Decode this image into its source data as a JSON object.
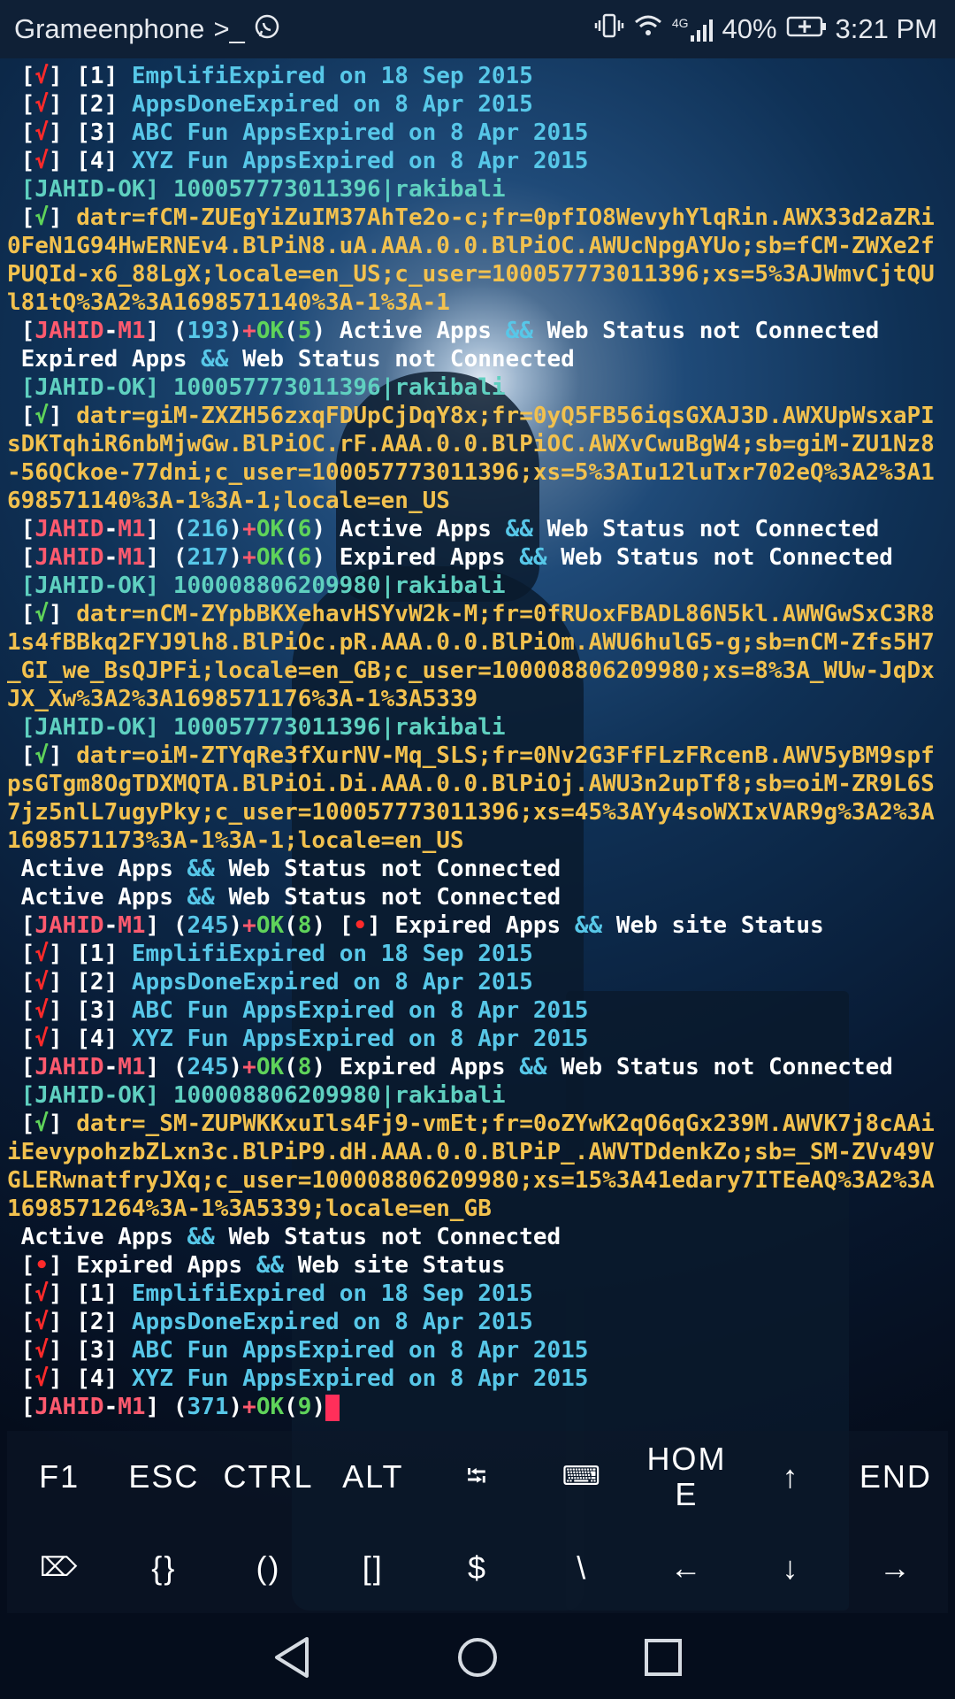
{
  "status_bar": {
    "carrier": "Grameenphone",
    "terminal_glyph": ">_",
    "network_label": "4G",
    "battery": "40%",
    "time": "3:21 PM"
  },
  "terminal": {
    "lines": [
      [
        [
          "w",
          " ["
        ],
        [
          "r",
          "√"
        ],
        [
          "w",
          "] [1] "
        ],
        [
          "c",
          "EmplifiExpired on 18 Sep 2015"
        ]
      ],
      [
        [
          "w",
          " ["
        ],
        [
          "r",
          "√"
        ],
        [
          "w",
          "] [2] "
        ],
        [
          "c",
          "AppsDoneExpired on 8 Apr 2015"
        ]
      ],
      [
        [
          "w",
          " ["
        ],
        [
          "r",
          "√"
        ],
        [
          "w",
          "] [3] "
        ],
        [
          "c",
          "ABC Fun AppsExpired on 8 Apr 2015"
        ]
      ],
      [
        [
          "w",
          " ["
        ],
        [
          "r",
          "√"
        ],
        [
          "w",
          "] [4] "
        ],
        [
          "c",
          "XYZ Fun AppsExpired on 8 Apr 2015"
        ]
      ],
      [
        [
          "tl",
          " [JAHID-OK] 100057773011396|rakibali"
        ]
      ],
      [
        [
          "w",
          " ["
        ],
        [
          "g",
          "√"
        ],
        [
          "w",
          "] "
        ],
        [
          "y",
          "datr=fCM-ZUEgYiZuIM37AhTe2o-c;fr=0pfIO8WevyhYlqRin.AWX33d2aZRi0FeN1G94HwERNEv4.BlPiN8.uA.AAA.0.0.BlPiOC.AWUcNpgAYUo;sb=fCM-ZWXe2fPUQId-x6_88LgX;locale=en_US;c_user=100057773011396;xs=5%3AJWmvCjtQUl81tQ%3A2%3A1698571140%3A-1%3A-1"
        ]
      ],
      [
        [
          "w",
          " ["
        ],
        [
          "p",
          "JAHID"
        ],
        [
          "w",
          "-"
        ],
        [
          "p",
          "M1"
        ],
        [
          "w",
          "] ("
        ],
        [
          "c",
          "193"
        ],
        [
          "w",
          ")"
        ],
        [
          "p",
          "+"
        ],
        [
          "g",
          "OK"
        ],
        [
          "w",
          "("
        ],
        [
          "g",
          "5"
        ],
        [
          "w",
          ") Active Apps "
        ],
        [
          "c",
          "&&"
        ],
        [
          "w",
          " Web Status not Connected"
        ]
      ],
      [
        [
          "w",
          " Expired Apps "
        ],
        [
          "c",
          "&&"
        ],
        [
          "w",
          " Web Status not Connected"
        ]
      ],
      [
        [
          "tl",
          " [JAHID-OK] 100057773011396|rakibali"
        ]
      ],
      [
        [
          "w",
          " ["
        ],
        [
          "g",
          "√"
        ],
        [
          "w",
          "] "
        ],
        [
          "y",
          "datr=giM-ZXZH56zxqFDUpCjDqY8x;fr=0yQ5FB56iqsGXAJ3D.AWXUpWsxaPIsDKTqhiR6nbMjwGw.BlPiOC.rF.AAA.0.0.BlPiOC.AWXvCwuBgW4;sb=giM-ZU1Nz8-56QCkoe-77dni;c_user=100057773011396;xs=5%3AIu12luTxr702eQ%3A2%3A1698571140%3A-1%3A-1;locale=en_US"
        ]
      ],
      [
        [
          "w",
          " ["
        ],
        [
          "p",
          "JAHID"
        ],
        [
          "w",
          "-"
        ],
        [
          "p",
          "M1"
        ],
        [
          "w",
          "] ("
        ],
        [
          "c",
          "216"
        ],
        [
          "w",
          ")"
        ],
        [
          "p",
          "+"
        ],
        [
          "g",
          "OK"
        ],
        [
          "w",
          "("
        ],
        [
          "g",
          "6"
        ],
        [
          "w",
          ") Active Apps "
        ],
        [
          "c",
          "&&"
        ],
        [
          "w",
          " Web Status not Connected"
        ]
      ],
      [
        [
          "w",
          " ["
        ],
        [
          "p",
          "JAHID"
        ],
        [
          "w",
          "-"
        ],
        [
          "p",
          "M1"
        ],
        [
          "w",
          "] ("
        ],
        [
          "c",
          "217"
        ],
        [
          "w",
          ")"
        ],
        [
          "p",
          "+"
        ],
        [
          "g",
          "OK"
        ],
        [
          "w",
          "("
        ],
        [
          "g",
          "6"
        ],
        [
          "w",
          ") Expired Apps "
        ],
        [
          "c",
          "&&"
        ],
        [
          "w",
          " Web Status not Connected"
        ]
      ],
      [
        [
          "tl",
          " [JAHID-OK] 100008806209980|rakibali"
        ]
      ],
      [
        [
          "w",
          " ["
        ],
        [
          "g",
          "√"
        ],
        [
          "w",
          "] "
        ],
        [
          "y",
          "datr=nCM-ZYpbBKXehavHSYvW2k-M;fr=0fRUoxFBADL86N5kl.AWWGwSxC3R81s4fBBkq2FYJ9lh8.BlPiOc.pR.AAA.0.0.BlPiOm.AWU6hulG5-g;sb=nCM-Zfs5H7_GI_we_BsQJPFi;locale=en_GB;c_user=100008806209980;xs=8%3A_WUw-JqDxJX_Xw%3A2%3A1698571176%3A-1%3A5339"
        ]
      ],
      [
        [
          "tl",
          " [JAHID-OK] 100057773011396|rakibali"
        ]
      ],
      [
        [
          "w",
          " ["
        ],
        [
          "g",
          "√"
        ],
        [
          "w",
          "] "
        ],
        [
          "y",
          "datr=oiM-ZTYqRe3fXurNV-Mq_SLS;fr=0Nv2G3FfFLzFRcenB.AWV5yBM9spfpsGTgm8OgTDXMQTA.BlPiOi.Di.AAA.0.0.BlPiOj.AWU3n2upTf8;sb=oiM-ZR9L6S7jz5nlL7ugyPky;c_user=100057773011396;xs=45%3AYy4soWXIxVAR9g%3A2%3A1698571173%3A-1%3A-1;locale=en_US"
        ]
      ],
      [
        [
          "w",
          " Active Apps "
        ],
        [
          "c",
          "&&"
        ],
        [
          "w",
          " Web Status not Connected"
        ]
      ],
      [
        [
          "w",
          " Active Apps "
        ],
        [
          "c",
          "&&"
        ],
        [
          "w",
          " Web Status not Connected"
        ]
      ],
      [
        [
          "w",
          " ["
        ],
        [
          "p",
          "JAHID"
        ],
        [
          "w",
          "-"
        ],
        [
          "p",
          "M1"
        ],
        [
          "w",
          "] ("
        ],
        [
          "c",
          "245"
        ],
        [
          "w",
          ")"
        ],
        [
          "p",
          "+"
        ],
        [
          "g",
          "OK"
        ],
        [
          "w",
          "("
        ],
        [
          "g",
          "8"
        ],
        [
          "w",
          ") ["
        ],
        [
          "r",
          "•"
        ],
        [
          "w",
          "] Expired Apps "
        ],
        [
          "c",
          "&&"
        ],
        [
          "w",
          " Web site Status"
        ]
      ],
      [
        [
          "w",
          " ["
        ],
        [
          "r",
          "√"
        ],
        [
          "w",
          "] [1] "
        ],
        [
          "c",
          "EmplifiExpired on 18 Sep 2015"
        ]
      ],
      [
        [
          "w",
          " ["
        ],
        [
          "r",
          "√"
        ],
        [
          "w",
          "] [2] "
        ],
        [
          "c",
          "AppsDoneExpired on 8 Apr 2015"
        ]
      ],
      [
        [
          "w",
          " ["
        ],
        [
          "r",
          "√"
        ],
        [
          "w",
          "] [3] "
        ],
        [
          "c",
          "ABC Fun AppsExpired on 8 Apr 2015"
        ]
      ],
      [
        [
          "w",
          " ["
        ],
        [
          "r",
          "√"
        ],
        [
          "w",
          "] [4] "
        ],
        [
          "c",
          "XYZ Fun AppsExpired on 8 Apr 2015"
        ]
      ],
      [
        [
          "w",
          " ["
        ],
        [
          "p",
          "JAHID"
        ],
        [
          "w",
          "-"
        ],
        [
          "p",
          "M1"
        ],
        [
          "w",
          "] ("
        ],
        [
          "c",
          "245"
        ],
        [
          "w",
          ")"
        ],
        [
          "p",
          "+"
        ],
        [
          "g",
          "OK"
        ],
        [
          "w",
          "("
        ],
        [
          "g",
          "8"
        ],
        [
          "w",
          ") Expired Apps "
        ],
        [
          "c",
          "&&"
        ],
        [
          "w",
          " Web Status not Connected"
        ]
      ],
      [
        [
          "tl",
          " [JAHID-OK] 100008806209980|rakibali"
        ]
      ],
      [
        [
          "w",
          " ["
        ],
        [
          "g",
          "√"
        ],
        [
          "w",
          "] "
        ],
        [
          "y",
          "datr=_SM-ZUPWKKxuIls4Fj9-vmEt;fr=0oZYwK2qO6qGx239M.AWVK7j8cAAiiEevypohzbZLxn3c.BlPiP9.dH.AAA.0.0.BlPiP_.AWVTDdenkZo;sb=_SM-ZVv49VGLERwnatfryJXq;c_user=100008806209980;xs=15%3A41edary7ITEeAQ%3A2%3A1698571264%3A-1%3A5339;locale=en_GB"
        ]
      ],
      [
        [
          "w",
          " Active Apps "
        ],
        [
          "c",
          "&&"
        ],
        [
          "w",
          " Web Status not Connected"
        ]
      ],
      [
        [
          "w",
          " ["
        ],
        [
          "r",
          "•"
        ],
        [
          "w",
          "] Expired Apps "
        ],
        [
          "c",
          "&&"
        ],
        [
          "w",
          " Web site Status"
        ]
      ],
      [
        [
          "w",
          " ["
        ],
        [
          "r",
          "√"
        ],
        [
          "w",
          "] [1] "
        ],
        [
          "c",
          "EmplifiExpired on 18 Sep 2015"
        ]
      ],
      [
        [
          "w",
          " ["
        ],
        [
          "r",
          "√"
        ],
        [
          "w",
          "] [2] "
        ],
        [
          "c",
          "AppsDoneExpired on 8 Apr 2015"
        ]
      ],
      [
        [
          "w",
          " ["
        ],
        [
          "r",
          "√"
        ],
        [
          "w",
          "] [3] "
        ],
        [
          "c",
          "ABC Fun AppsExpired on 8 Apr 2015"
        ]
      ],
      [
        [
          "w",
          " ["
        ],
        [
          "r",
          "√"
        ],
        [
          "w",
          "] [4] "
        ],
        [
          "c",
          "XYZ Fun AppsExpired on 8 Apr 2015"
        ]
      ],
      [
        [
          "w",
          " ["
        ],
        [
          "p",
          "JAHID"
        ],
        [
          "w",
          "-"
        ],
        [
          "p",
          "M1"
        ],
        [
          "w",
          "] ("
        ],
        [
          "c",
          "371"
        ],
        [
          "w",
          ")"
        ],
        [
          "p",
          "+"
        ],
        [
          "g",
          "OK"
        ],
        [
          "w",
          "("
        ],
        [
          "g",
          "9"
        ],
        [
          "w",
          ")"
        ]
      ]
    ]
  },
  "extra_keys": {
    "row1": [
      "F1",
      "ESC",
      "CTRL",
      "ALT",
      "⭾",
      "⌨",
      "HOME",
      "↑",
      "END"
    ],
    "row2": [
      "⌦",
      "{}",
      "()",
      "[]",
      "$",
      "\\",
      "←",
      "↓",
      "→"
    ]
  },
  "nav": [
    "back-icon",
    "home-icon",
    "recents-icon"
  ]
}
